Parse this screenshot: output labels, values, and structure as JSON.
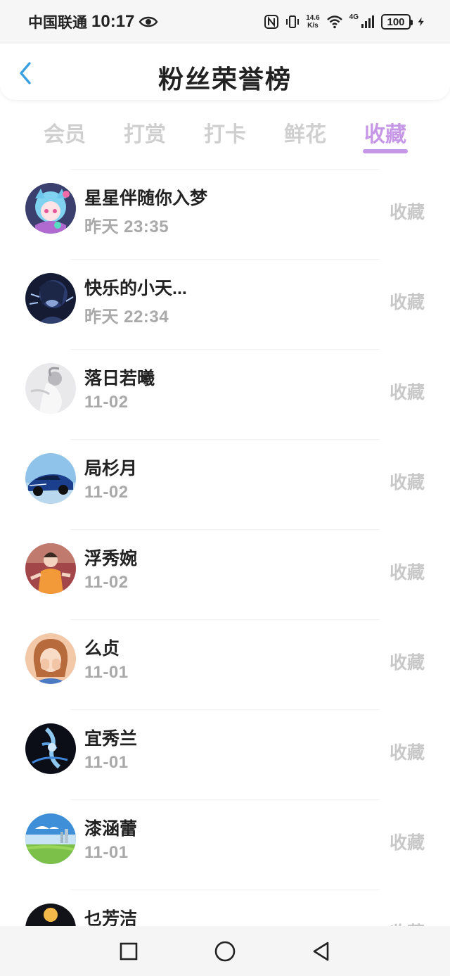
{
  "status_bar": {
    "carrier": "中国联通",
    "time": "10:17",
    "speed_value": "14.6",
    "speed_unit": "K/s",
    "network": "4G",
    "battery": "100"
  },
  "header": {
    "title": "粉丝荣誉榜"
  },
  "tabs": [
    {
      "label": "会员",
      "active": false
    },
    {
      "label": "打赏",
      "active": false
    },
    {
      "label": "打卡",
      "active": false
    },
    {
      "label": "鲜花",
      "active": false
    },
    {
      "label": "收藏",
      "active": true
    }
  ],
  "fans": [
    {
      "name": "星星伴随你入梦",
      "time": "昨天 23:35",
      "action": "收藏",
      "avatar": "anime-girl"
    },
    {
      "name": "快乐的小天...",
      "time": "昨天 22:34",
      "action": "收藏",
      "avatar": "dark-portrait"
    },
    {
      "name": "落日若曦",
      "time": "11-02",
      "action": "收藏",
      "avatar": "grey-figure"
    },
    {
      "name": "局杉月",
      "time": "11-02",
      "action": "收藏",
      "avatar": "blue-car"
    },
    {
      "name": "浮秀婉",
      "time": "11-02",
      "action": "收藏",
      "avatar": "boy-cartoon"
    },
    {
      "name": "么贞",
      "time": "11-01",
      "action": "收藏",
      "avatar": "girl-hands"
    },
    {
      "name": "宜秀兰",
      "time": "11-01",
      "action": "收藏",
      "avatar": "dark-energy"
    },
    {
      "name": "漆涵蕾",
      "time": "11-01",
      "action": "收藏",
      "avatar": "sky-landscape"
    },
    {
      "name": "乜芳洁",
      "time": "",
      "action": "收藏",
      "avatar": "night-city"
    }
  ],
  "colors": {
    "accent": "#c597e6",
    "back_arrow": "#3aa0e0",
    "inactive_tab": "#cfcfcf",
    "secondary_text": "#a9a9a9"
  }
}
